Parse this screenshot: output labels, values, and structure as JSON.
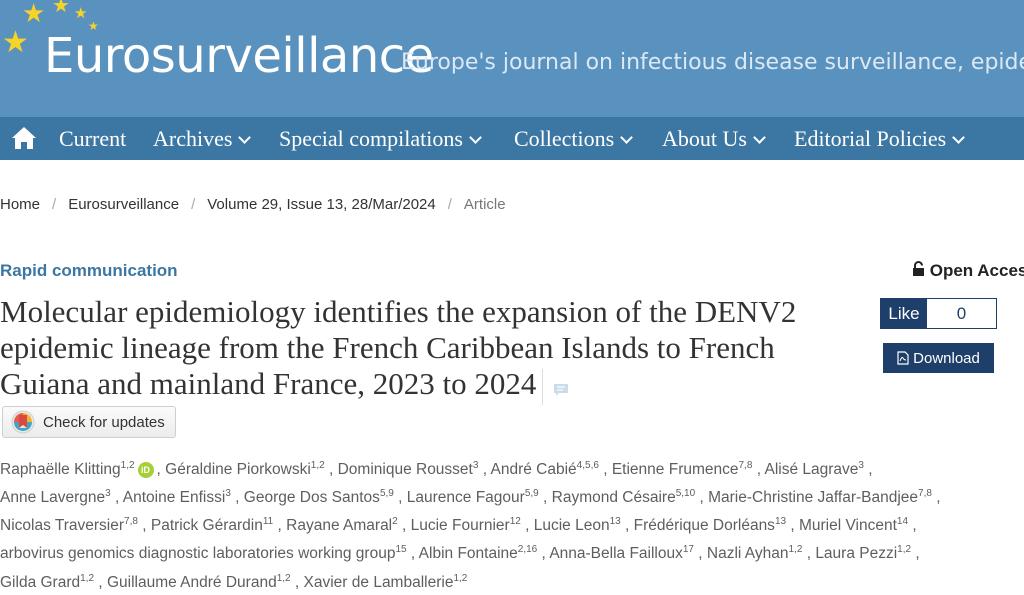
{
  "header": {
    "logo": "Eurosurveillance",
    "tagline": "Europe's journal on infectious disease surveillance, epidemiology, prevention and control"
  },
  "nav": {
    "home_icon": "home-icon",
    "items": [
      {
        "label": "Current",
        "has_dropdown": false
      },
      {
        "label": "Archives",
        "has_dropdown": true
      },
      {
        "label": "Special compilations",
        "has_dropdown": true
      },
      {
        "label": "Collections",
        "has_dropdown": true
      },
      {
        "label": "About Us",
        "has_dropdown": true
      },
      {
        "label": "Editorial Policies",
        "has_dropdown": true
      }
    ]
  },
  "breadcrumb": [
    "Home",
    "Eurosurveillance",
    "Volume 29, Issue 13, 28/Mar/2024",
    "Article"
  ],
  "article": {
    "type": "Rapid communication",
    "open_access": "Open Access",
    "title": "Molecular epidemiology identifies the expansion of the DENV2 epidemic lineage from the French Caribbean Islands to French Guiana and mainland France, 2023 to 2024"
  },
  "social": {
    "like_label": "Like",
    "like_count": "0"
  },
  "actions": {
    "download_label": "Download",
    "check_updates_label": "Check for updates"
  },
  "authors": [
    {
      "name": "Raphaëlle Klitting",
      "aff": "1,2"
    },
    {
      "name": "Géraldine Piorkowski",
      "aff": "1,2"
    },
    {
      "name": "Dominique Rousset",
      "aff": "3"
    },
    {
      "name": "André Cabié",
      "aff": "4,5,6"
    },
    {
      "name": "Etienne Frumence",
      "aff": "7,8"
    },
    {
      "name": "Alisé Lagrave",
      "aff": "3"
    },
    {
      "name": "Anne Lavergne",
      "aff": "3"
    },
    {
      "name": "Antoine Enfissi",
      "aff": "3"
    },
    {
      "name": "George Dos Santos",
      "aff": "5,9"
    },
    {
      "name": "Laurence Fagour",
      "aff": "5,9"
    },
    {
      "name": "Raymond Césaire",
      "aff": "5,10"
    },
    {
      "name": "Marie-Christine Jaffar-Bandjee",
      "aff": "7,8"
    },
    {
      "name": "Nicolas Traversier",
      "aff": "7,8"
    },
    {
      "name": "Patrick Gérardin",
      "aff": "11"
    },
    {
      "name": "Rayane Amaral",
      "aff": "2"
    },
    {
      "name": "Lucie Fournier",
      "aff": "12"
    },
    {
      "name": "Lucie Leon",
      "aff": "13"
    },
    {
      "name": "Frédérique Dorléans",
      "aff": "13"
    },
    {
      "name": "Muriel Vincent",
      "aff": "14"
    },
    {
      "name": "arbovirus genomics diagnostic laboratories working group",
      "aff": "15"
    },
    {
      "name": "Albin Fontaine",
      "aff": "2,16"
    },
    {
      "name": "Anna-Bella Failloux",
      "aff": "17"
    },
    {
      "name": "Nazli Ayhan",
      "aff": "1,2"
    },
    {
      "name": "Laura Pezzi",
      "aff": "1,2"
    },
    {
      "name": "Gilda Grard",
      "aff": "1,2"
    },
    {
      "name": "Guillaume André Durand",
      "aff": "1,2"
    },
    {
      "name": "Xavier de Lamballerie",
      "aff": "1,2"
    }
  ],
  "colors": {
    "masthead": "#5a92bf",
    "navbar": "#3c77a3",
    "star": "#f5d327",
    "button": "#1e3f6a",
    "orcid": "#a6ce39"
  }
}
